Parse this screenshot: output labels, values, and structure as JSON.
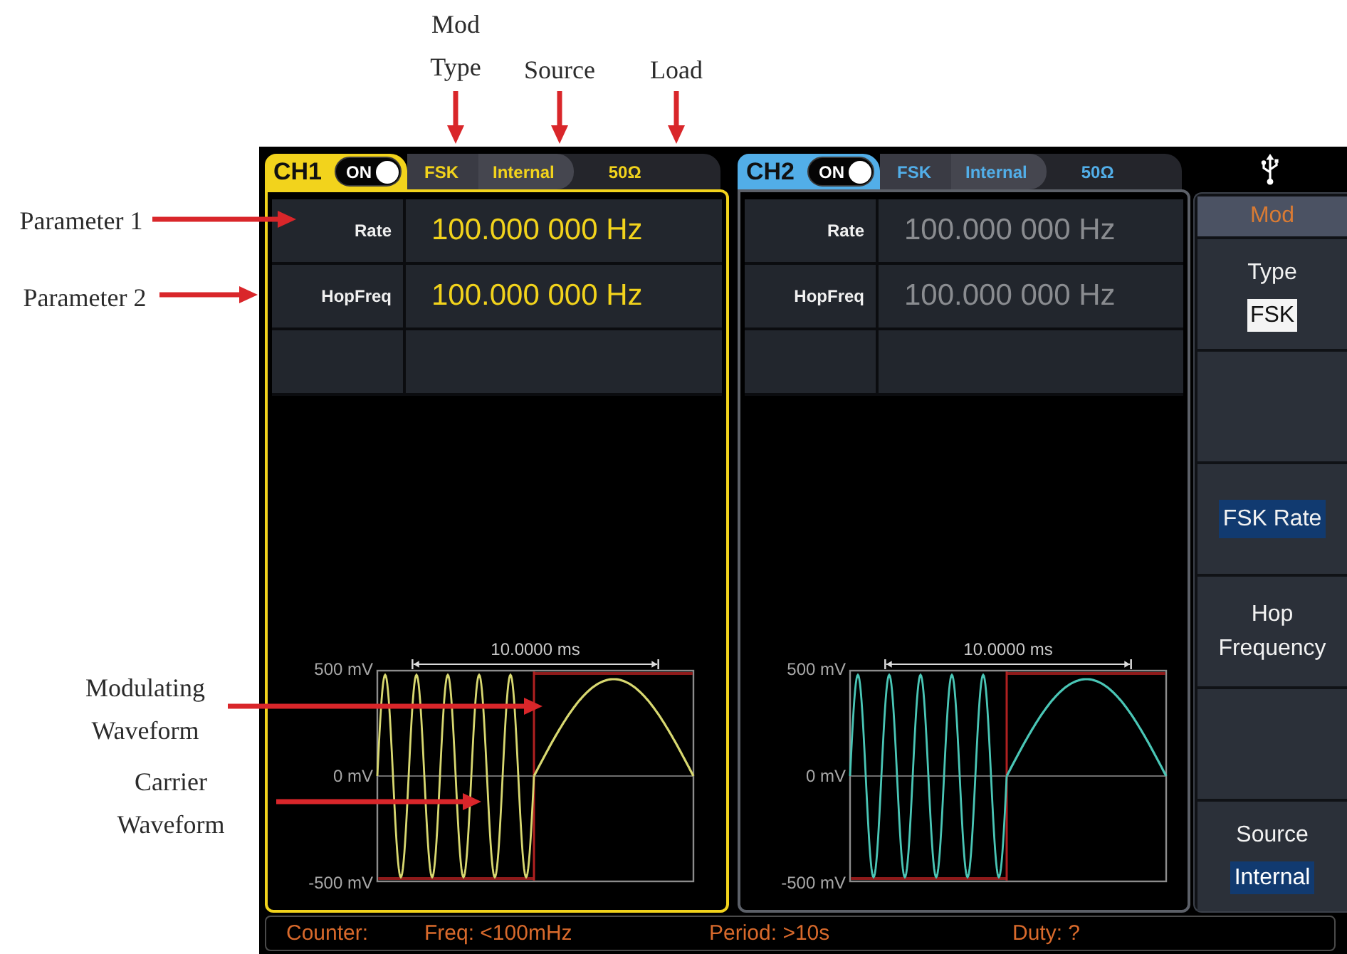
{
  "callouts": {
    "top": [
      {
        "label": "Mod Type"
      },
      {
        "label": "Source"
      },
      {
        "label": "Load"
      }
    ],
    "left": [
      {
        "label": "Parameter 1"
      },
      {
        "label": "Parameter 2"
      },
      {
        "label": "Modulating Waveform"
      },
      {
        "label": "Carrier Waveform"
      }
    ]
  },
  "channels": [
    {
      "name": "CH1",
      "color": "#f2d31c",
      "selected": true,
      "on": true,
      "output_label": "ON",
      "mod_type": "FSK",
      "source": "Internal",
      "load": "50Ω",
      "params": [
        {
          "label": "Rate",
          "value": "100.000 000 Hz"
        },
        {
          "label": "HopFreq",
          "value": "100.000 000 Hz"
        }
      ],
      "waveform": {
        "color": "#d8d870",
        "time_span": "10.0000 ms",
        "y_labels": [
          "500 mV",
          "0 mV",
          "-500 mV"
        ]
      }
    },
    {
      "name": "CH2",
      "color": "#52aee8",
      "selected": false,
      "on": true,
      "output_label": "ON",
      "mod_type": "FSK",
      "source": "Internal",
      "load": "50Ω",
      "params": [
        {
          "label": "Rate",
          "value": "100.000 000 Hz"
        },
        {
          "label": "HopFreq",
          "value": "100.000 000 Hz"
        }
      ],
      "waveform": {
        "color": "#4ac6b6",
        "time_span": "10.0000 ms",
        "y_labels": [
          "500 mV",
          "0 mV",
          "-500 mV"
        ]
      }
    }
  ],
  "softkey_menu": {
    "title": "Mod",
    "keys": [
      {
        "kind": "choice",
        "label": "Type",
        "value": "FSK",
        "selected": false
      },
      {
        "kind": "blank",
        "selected": false
      },
      {
        "kind": "action",
        "label": "FSK Rate",
        "selected": true
      },
      {
        "kind": "action",
        "label": "Hop Frequency",
        "selected": false
      },
      {
        "kind": "blank",
        "selected": false
      },
      {
        "kind": "option",
        "label": "Source",
        "value": "Internal",
        "selected": false
      }
    ]
  },
  "status_bar": {
    "label": "Counter:",
    "readings": [
      "Freq: <100mHz",
      "Period: >10s",
      "Duty: ?"
    ]
  }
}
